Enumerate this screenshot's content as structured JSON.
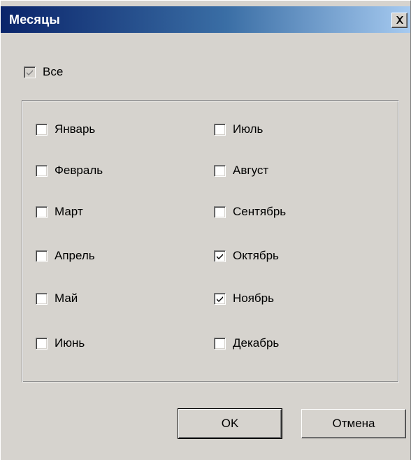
{
  "window": {
    "title": "Месяцы",
    "close_label": "×"
  },
  "all_checkbox": {
    "label": "Все",
    "checked": true,
    "disabled": true
  },
  "months": [
    {
      "label": "Январь",
      "checked": false
    },
    {
      "label": "Февраль",
      "checked": false
    },
    {
      "label": "Март",
      "checked": false
    },
    {
      "label": "Апрель",
      "checked": false
    },
    {
      "label": "Май",
      "checked": false
    },
    {
      "label": "Июнь",
      "checked": false
    },
    {
      "label": "Июль",
      "checked": false
    },
    {
      "label": "Август",
      "checked": false
    },
    {
      "label": "Сентябрь",
      "checked": false
    },
    {
      "label": "Октябрь",
      "checked": true
    },
    {
      "label": "Ноябрь",
      "checked": true
    },
    {
      "label": "Декабрь",
      "checked": false
    }
  ],
  "buttons": {
    "ok_label": "OK",
    "cancel_label": "Отмена"
  }
}
